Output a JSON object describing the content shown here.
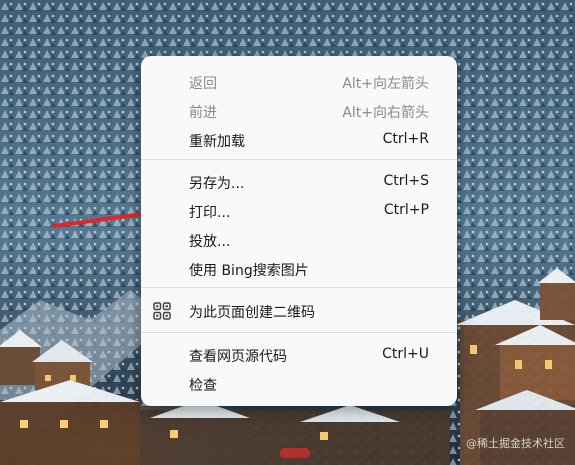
{
  "colors": {
    "menu_bg": "#f9f9f9",
    "text": "#1a1a1a",
    "disabled_text": "#8a8a8a",
    "separator": "#e1e1e1",
    "arrow": "#e0262a"
  },
  "menu": {
    "items": [
      {
        "label": "返回",
        "shortcut": "Alt+向左箭头",
        "disabled": true
      },
      {
        "label": "前进",
        "shortcut": "Alt+向右箭头",
        "disabled": true
      },
      {
        "label": "重新加载",
        "shortcut": "Ctrl+R",
        "disabled": false
      },
      {
        "label": "另存为...",
        "shortcut": "Ctrl+S",
        "disabled": false
      },
      {
        "label": "打印...",
        "shortcut": "Ctrl+P",
        "disabled": false
      },
      {
        "label": "投放...",
        "shortcut": "",
        "disabled": false
      },
      {
        "label": "使用 Bing搜索图片",
        "shortcut": "",
        "disabled": false
      },
      {
        "label": "为此页面创建二维码",
        "shortcut": "",
        "disabled": false,
        "icon": "qr-code-icon"
      },
      {
        "label": "查看网页源代码",
        "shortcut": "Ctrl+U",
        "disabled": false
      },
      {
        "label": "检查",
        "shortcut": "",
        "disabled": false
      }
    ]
  },
  "watermark": "@稀土掘金技术社区",
  "annotation_arrow": "red-arrow-icon"
}
